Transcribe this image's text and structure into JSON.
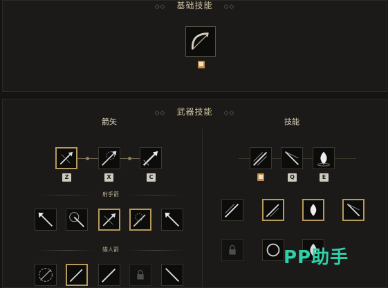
{
  "basic": {
    "title": "基础技能"
  },
  "weapon": {
    "title": "武器技能",
    "arrows_header": "箭矢",
    "skills_header": "技能",
    "archer_subheader": "射手箭",
    "hunter_subheader": "猎人箭",
    "arrow_keys": [
      "Z",
      "X",
      "C"
    ],
    "skill_keys": [
      "Q",
      "E"
    ]
  },
  "watermark": {
    "text": "PP助手"
  },
  "colors": {
    "accent_gold": "#b89a5b",
    "watermark": "#2fd0a8",
    "background": "#151413"
  },
  "icons": [
    "bow-icon",
    "scatter-arrow-icon",
    "burst-arrow-icon",
    "spear-arrow-icon",
    "multi-arrow-icon",
    "fire-flame-icon",
    "spread-arrow-icon",
    "hook-arrow-icon",
    "lock-icon",
    "skillbook-icon"
  ]
}
